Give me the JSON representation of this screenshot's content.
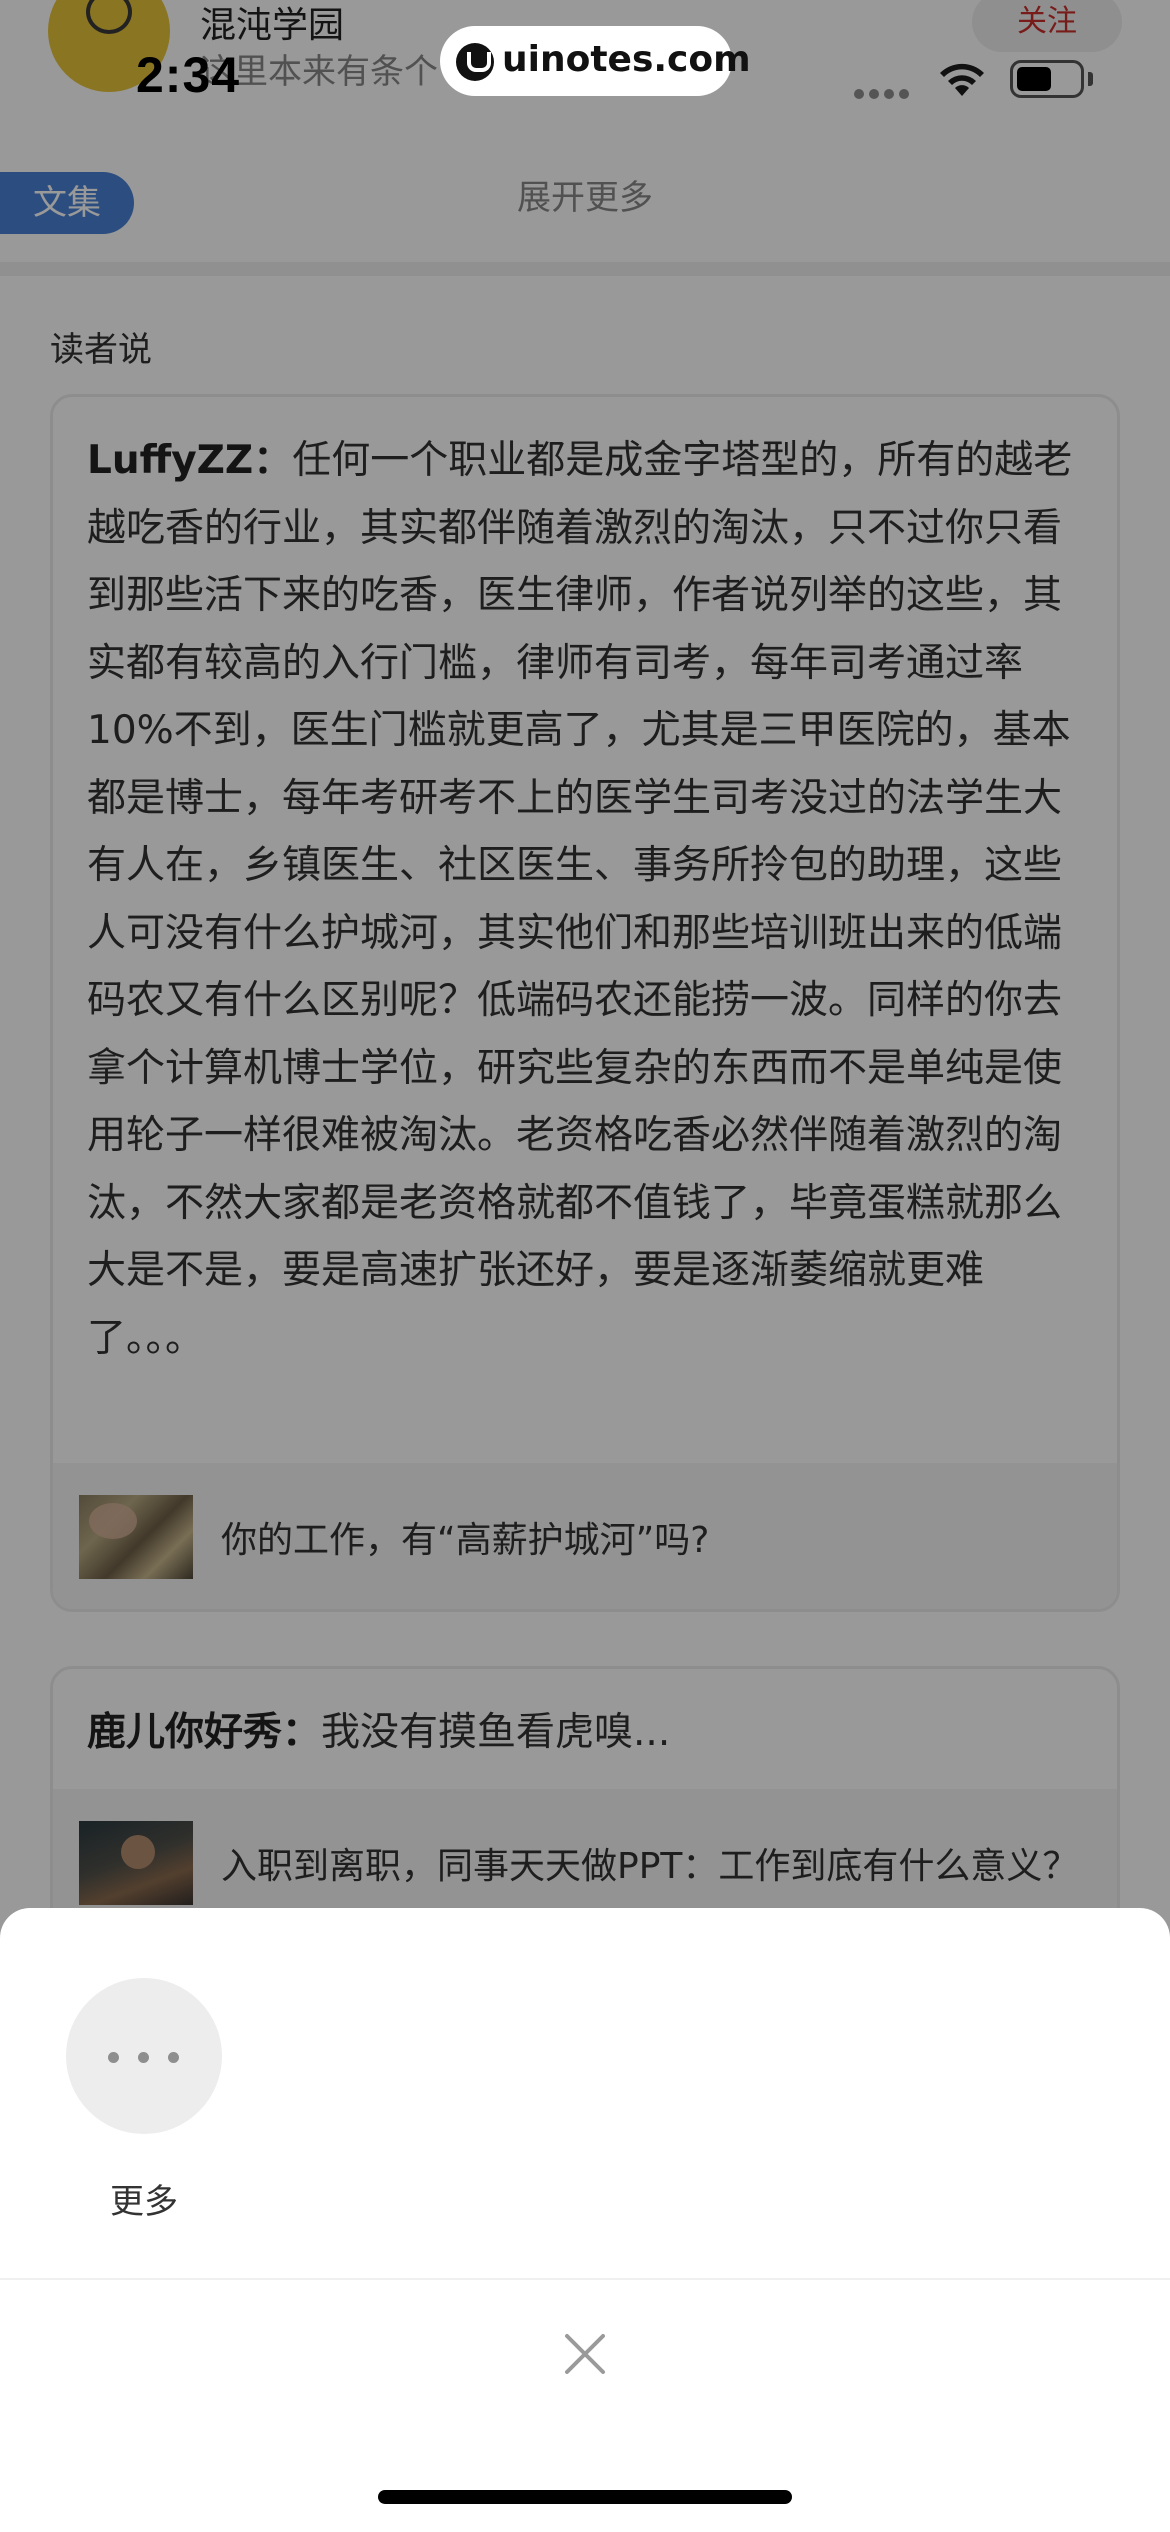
{
  "status_bar": {
    "time": "2:34",
    "watermark": "uinotes.com",
    "battery_level": 0.55
  },
  "author": {
    "name": "混沌学园",
    "description": "这里本来有条个",
    "follow_label": "关注"
  },
  "collection_tag": "文集",
  "expand_more": "展开更多",
  "readers_section_title": "读者说",
  "comments": [
    {
      "user": "LuffyZZ",
      "separator": "：",
      "text": "任何一个职业都是成金字塔型的，所有的越老越吃香的行业，其实都伴随着激烈的淘汰，只不过你只看到那些活下来的吃香，医生律师，作者说列举的这些，其实都有较高的入行门槛，律师有司考，每年司考通过率10%不到，医生门槛就更高了，尤其是三甲医院的，基本都是博士，每年考研考不上的医学生司考没过的法学生大有人在，乡镇医生、社区医生、事务所拎包的助理，这些人可没有什么护城河，其实他们和那些培训班出来的低端码农又有什么区别呢？低端码农还能捞一波。同样的你去拿个计算机博士学位，研究些复杂的东西而不是单纯是使用轮子一样很难被淘汰。老资格吃香必然伴随着激烈的淘汰，不然大家都是老资格就都不值钱了，毕竟蛋糕就那么大是不是，要是高速扩张还好，要是逐渐萎缩就更难了。。。",
      "article_title": "你的工作，有“高薪护城河”吗?"
    },
    {
      "user": "鹿儿你好秀",
      "separator": "：",
      "text": "我没有摸鱼看虎嗅...",
      "article_title": "入职到离职，同事天天做PPT：工作到底有什么意义？"
    }
  ],
  "share_sheet": {
    "actions": [
      {
        "label": "更多",
        "icon": "more-dots-icon"
      }
    ],
    "close_icon": "close-icon"
  }
}
